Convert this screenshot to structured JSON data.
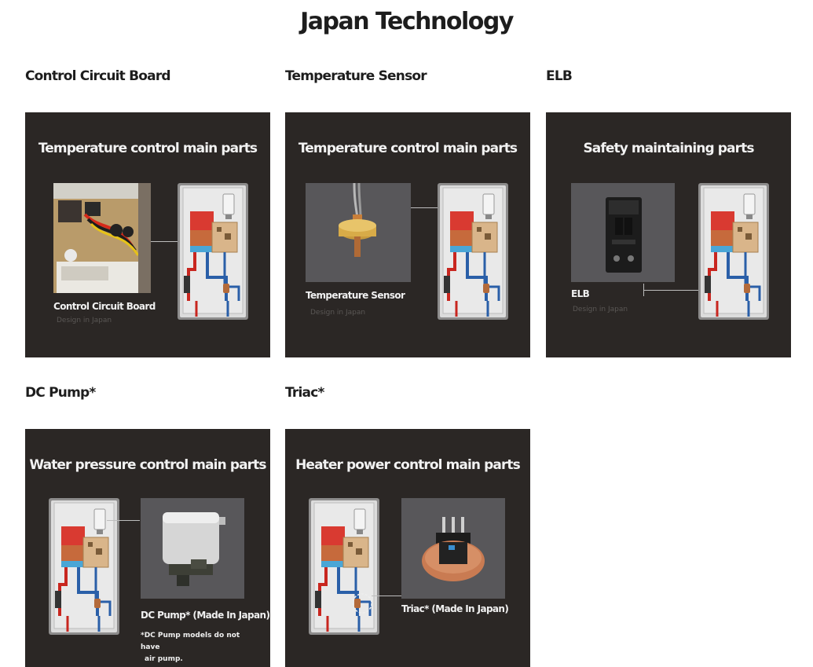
{
  "page": {
    "title": "Japan Technology"
  },
  "cards": [
    {
      "heading": "Control Circuit Board",
      "panel_title": "Temperature control main parts",
      "caption": "Control Circuit Board",
      "sub_caption": "Design in Japan"
    },
    {
      "heading": "Temperature Sensor",
      "panel_title": "Temperature control main parts",
      "caption": "Temperature Sensor",
      "sub_caption": "Design in Japan"
    },
    {
      "heading": "ELB",
      "panel_title": "Safety maintaining parts",
      "caption": "ELB",
      "sub_caption": "Design in Japan"
    },
    {
      "heading": "DC Pump*",
      "panel_title": "Water pressure control main parts",
      "caption": "DC Pump* (Made In Japan)",
      "note_line1": "*DC Pump models do not have",
      "note_line2": "air pump."
    },
    {
      "heading": "Triac*",
      "panel_title": "Heater power control main parts",
      "caption": "Triac* (Made In Japan)"
    }
  ],
  "colors": {
    "panel_bg": "#2b2725",
    "photo_bg": "#58575a",
    "hot_pipe": "#c8261f",
    "cold_pipe": "#2a5fa8"
  }
}
